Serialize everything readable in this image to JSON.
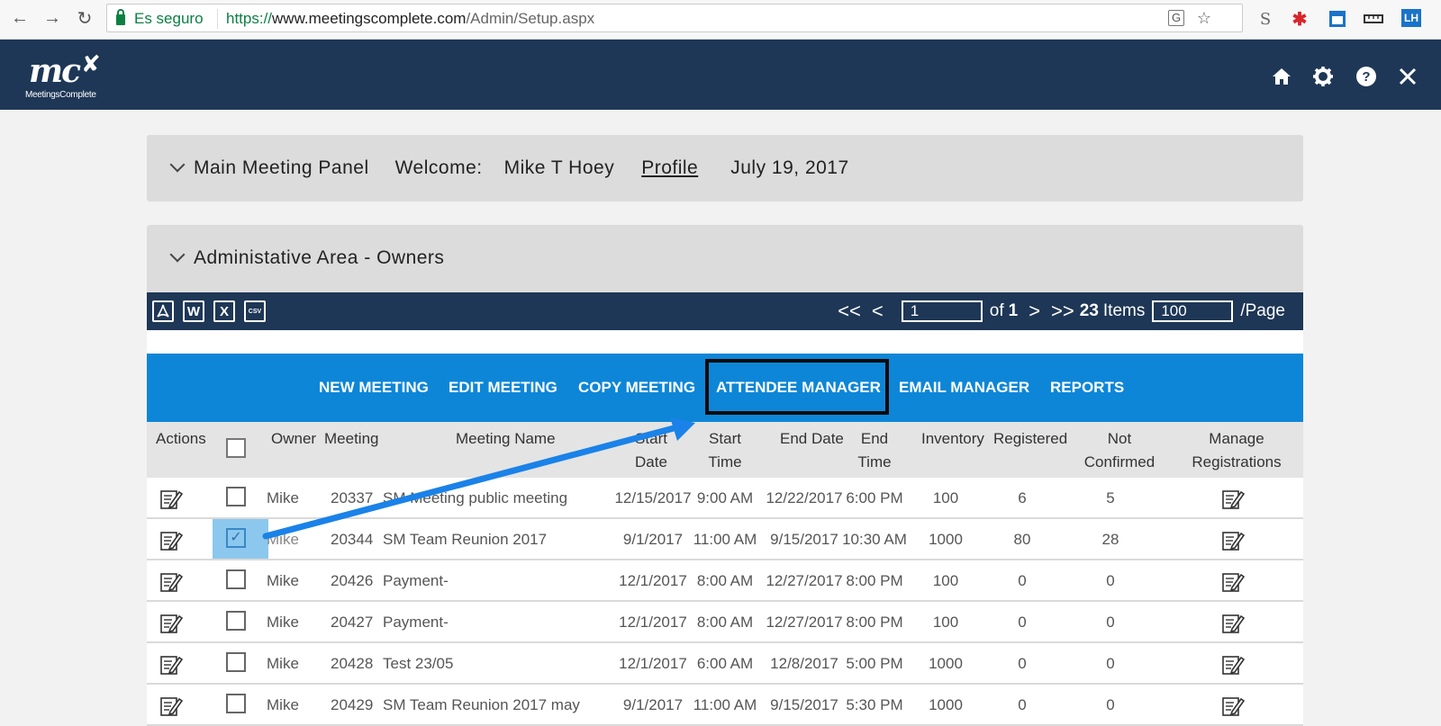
{
  "browser": {
    "secure_label": "Es seguro",
    "url_scheme": "https://",
    "url_host": "www.meetingscomplete.com",
    "url_path": "/Admin/Setup.aspx"
  },
  "header": {
    "logo_text": "mc",
    "logo_sub": "MeetingsComplete"
  },
  "main_panel": {
    "title": "Main Meeting Panel",
    "welcome_label": "Welcome:",
    "user_name": "Mike T Hoey",
    "profile_link": "Profile",
    "date": "July 19, 2017"
  },
  "admin_panel": {
    "title": "Administative Area - Owners"
  },
  "toolbar": {
    "export_pdf": "PDF",
    "export_word": "W",
    "export_excel": "X",
    "export_csv": "CSV",
    "first": "<<",
    "prev": "<",
    "page_value": "1",
    "of_label": "of",
    "total_pages": "1",
    "next": ">",
    "last": ">>",
    "items_count": "23",
    "items_label": "Items",
    "page_size": "100",
    "per_page_label": "/Page"
  },
  "actions": {
    "new_meeting": "NEW MEETING",
    "edit_meeting": "EDIT MEETING",
    "copy_meeting": "COPY MEETING",
    "attendee_manager": "ATTENDEE MANAGER",
    "email_manager": "EMAIL MANAGER",
    "reports": "REPORTS"
  },
  "table": {
    "headers": {
      "actions": "Actions",
      "owner": "Owner",
      "meeting": "Meeting",
      "meeting_name": "Meeting Name",
      "start_date_1": "Start",
      "start_date_2": "Date",
      "start_time_1": "Start",
      "start_time_2": "Time",
      "end_date": "End Date",
      "end_time_1": "End",
      "end_time_2": "Time",
      "inventory": "Inventory",
      "registered": "Registered",
      "not_confirmed_1": "Not",
      "not_confirmed_2": "Confirmed",
      "manage_1": "Manage",
      "manage_2": "Registrations"
    },
    "rows": [
      {
        "owner": "Mike",
        "meeting": "20337",
        "name": "SM Meeting public meeting",
        "start_date": "12/15/2017",
        "start_time": "9:00 AM",
        "end_date": "12/22/2017",
        "end_time": "6:00 PM",
        "inventory": "100",
        "registered": "6",
        "not_confirmed": "5"
      },
      {
        "owner": "Mike",
        "meeting": "20344",
        "name": "SM Team Reunion 2017",
        "start_date": "9/1/2017",
        "start_time": "11:00 AM",
        "end_date": "9/15/2017",
        "end_time": "10:30 AM",
        "inventory": "1000",
        "registered": "80",
        "not_confirmed": "28"
      },
      {
        "owner": "Mike",
        "meeting": "20426",
        "name": "Payment-",
        "start_date": "12/1/2017",
        "start_time": "8:00 AM",
        "end_date": "12/27/2017",
        "end_time": "8:00 PM",
        "inventory": "100",
        "registered": "0",
        "not_confirmed": "0"
      },
      {
        "owner": "Mike",
        "meeting": "20427",
        "name": "Payment-",
        "start_date": "12/1/2017",
        "start_time": "8:00 AM",
        "end_date": "12/27/2017",
        "end_time": "8:00 PM",
        "inventory": "100",
        "registered": "0",
        "not_confirmed": "0"
      },
      {
        "owner": "Mike",
        "meeting": "20428",
        "name": "Test 23/05",
        "start_date": "12/1/2017",
        "start_time": "6:00 AM",
        "end_date": "12/8/2017",
        "end_time": "5:00 PM",
        "inventory": "1000",
        "registered": "0",
        "not_confirmed": "0"
      },
      {
        "owner": "Mike",
        "meeting": "20429",
        "name": "SM Team Reunion 2017 may",
        "start_date": "9/1/2017",
        "start_time": "11:00 AM",
        "end_date": "9/15/2017",
        "end_time": "5:30 PM",
        "inventory": "1000",
        "registered": "0",
        "not_confirmed": "0"
      }
    ]
  },
  "colors": {
    "header_bg": "#1e3756",
    "action_bar_bg": "#0d86d8",
    "annotation_arrow": "#1a82e8"
  },
  "icons": {
    "nav": [
      "back-icon",
      "forward-icon",
      "reload-icon"
    ],
    "omnibox": [
      "translate-icon",
      "star-icon"
    ],
    "header": [
      "home-icon",
      "gear-icon",
      "help-icon",
      "close-icon"
    ],
    "row": [
      "edit-icon",
      "manage-registrations-icon"
    ]
  }
}
